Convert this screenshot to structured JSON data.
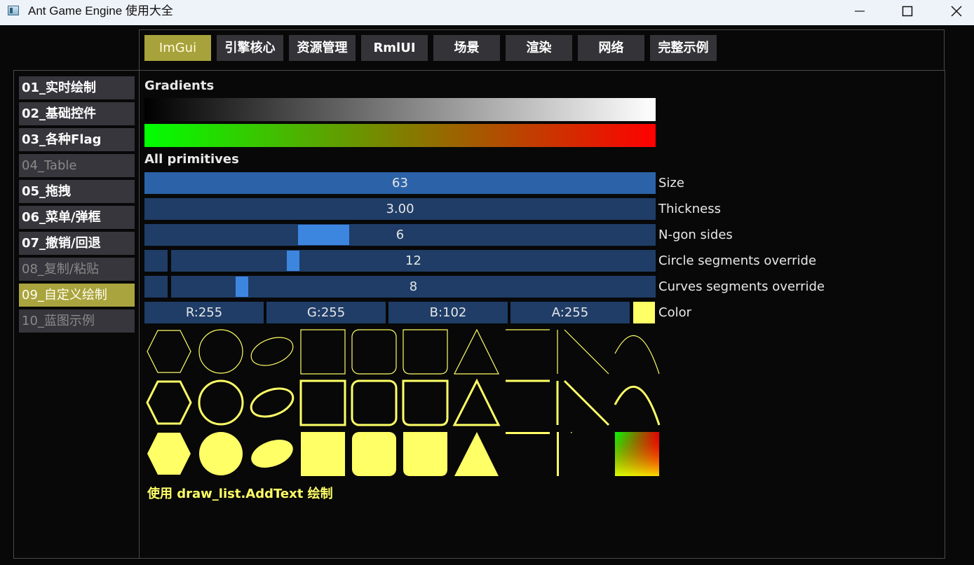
{
  "window": {
    "title": "Ant Game Engine 使用大全"
  },
  "tabs": [
    {
      "label": "ImGui"
    },
    {
      "label": "引擎核心"
    },
    {
      "label": "资源管理"
    },
    {
      "label": "RmlUI"
    },
    {
      "label": "场景"
    },
    {
      "label": "渲染"
    },
    {
      "label": "网络"
    },
    {
      "label": "完整示例"
    }
  ],
  "active_tab": "ImGui",
  "sidebar": {
    "items": [
      {
        "label": "01_实时绘制"
      },
      {
        "label": "02_基础控件"
      },
      {
        "label": "03_各种Flag"
      },
      {
        "label": "04_Table"
      },
      {
        "label": "05_拖拽"
      },
      {
        "label": "06_菜单/弹框"
      },
      {
        "label": "07_撤销/回退"
      },
      {
        "label": "08_复制/粘贴"
      },
      {
        "label": "09_自定义绘制"
      },
      {
        "label": "10_蓝图示例"
      }
    ],
    "active": "09_自定义绘制"
  },
  "main": {
    "gradients_label": "Gradients",
    "primitives_label": "All primitives",
    "size": {
      "value": "63",
      "label": "Size"
    },
    "thickness": {
      "value": "3.00",
      "label": "Thickness"
    },
    "ngon": {
      "value": "6",
      "label": "N-gon sides"
    },
    "circle_segments": {
      "value": "12",
      "label": "Circle segments override"
    },
    "curve_segments": {
      "value": "8",
      "label": "Curves segments override"
    },
    "color": {
      "r": "R:255",
      "g": "G:255",
      "b": "B:102",
      "a": "A:255",
      "label": "Color",
      "swatch": "#ffff66"
    },
    "footer_text": "使用 draw_list.AddText 绘制"
  },
  "colors": {
    "accent": "#a7a23b",
    "slider_bg": "#1f3d67",
    "slider_active": "#2c63a8",
    "grab": "#3d86e0",
    "primitive": "#ffff66"
  }
}
